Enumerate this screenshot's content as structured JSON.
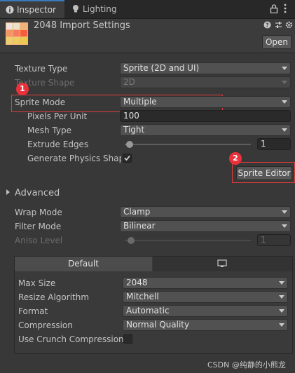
{
  "tabs": [
    {
      "label": "Inspector",
      "icon": "info-icon"
    },
    {
      "label": "Lighting",
      "icon": "lightbulb-icon"
    }
  ],
  "header": {
    "title": "2048 Import Settings",
    "open_label": "Open"
  },
  "fields": {
    "texture_type": {
      "label": "Texture Type",
      "value": "Sprite (2D and UI)"
    },
    "texture_shape": {
      "label": "Texture Shape",
      "value": "2D"
    },
    "sprite_mode": {
      "label": "Sprite Mode",
      "value": "Multiple"
    },
    "pixels_per_unit": {
      "label": "Pixels Per Unit",
      "value": "100"
    },
    "mesh_type": {
      "label": "Mesh Type",
      "value": "Tight"
    },
    "extrude_edges": {
      "label": "Extrude Edges",
      "value": "1"
    },
    "generate_physics_shape": {
      "label": "Generate Physics Shape",
      "checked": true
    },
    "sprite_editor": {
      "label": "Sprite Editor"
    },
    "advanced": {
      "label": "Advanced"
    },
    "wrap_mode": {
      "label": "Wrap Mode",
      "value": "Clamp"
    },
    "filter_mode": {
      "label": "Filter Mode",
      "value": "Bilinear"
    },
    "aniso_level": {
      "label": "Aniso Level",
      "value": "1"
    }
  },
  "platform": {
    "default_tab": "Default",
    "max_size": {
      "label": "Max Size",
      "value": "2048"
    },
    "resize_algorithm": {
      "label": "Resize Algorithm",
      "value": "Mitchell"
    },
    "format": {
      "label": "Format",
      "value": "Automatic"
    },
    "compression": {
      "label": "Compression",
      "value": "Normal Quality"
    },
    "use_crunch": {
      "label": "Use Crunch Compression",
      "checked": false
    }
  },
  "annotations": {
    "badge1": "1",
    "badge2": "2"
  },
  "watermark": "CSDN @纯静的小熊龙",
  "colors": {
    "accent": "#3a79bb",
    "annotation_red": "#e8313a"
  }
}
